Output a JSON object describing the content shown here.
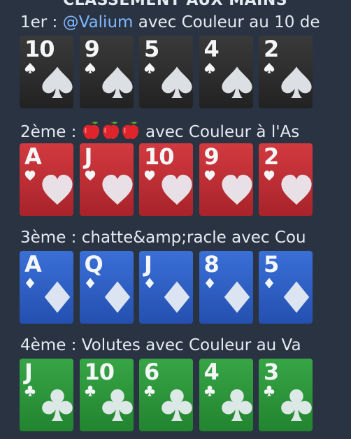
{
  "header": {
    "title": "CLASSEMENT AUX MAINS"
  },
  "rankings": [
    {
      "position": "1er :",
      "name": "@Valium",
      "is_mention": true,
      "hand": "avec Couleur au 10 de",
      "suit": "spades",
      "cards": [
        "10",
        "9",
        "5",
        "4",
        "2"
      ]
    },
    {
      "position": "2ème :",
      "name_emoji": [
        "apple",
        "apple",
        "apple"
      ],
      "hand": "avec Couleur à l'As",
      "suit": "hearts",
      "cards": [
        "A",
        "J",
        "10",
        "9",
        "2"
      ]
    },
    {
      "position": "3ème :",
      "name": "chatte&amp;racle",
      "hand": "avec Cou",
      "suit": "diamonds",
      "cards": [
        "A",
        "Q",
        "J",
        "8",
        "5"
      ]
    },
    {
      "position": "4ème :",
      "name": "Volutes",
      "hand": "avec Couleur au Va",
      "suit": "clubs",
      "cards": [
        "J",
        "10",
        "6",
        "4",
        "3"
      ]
    }
  ],
  "colors": {
    "background": "#2a3342",
    "mention": "#7fb8ff",
    "spades": "#2d2d2d",
    "hearts": "#c42f35",
    "diamonds": "#2f60c6",
    "clubs": "#2c953b"
  }
}
